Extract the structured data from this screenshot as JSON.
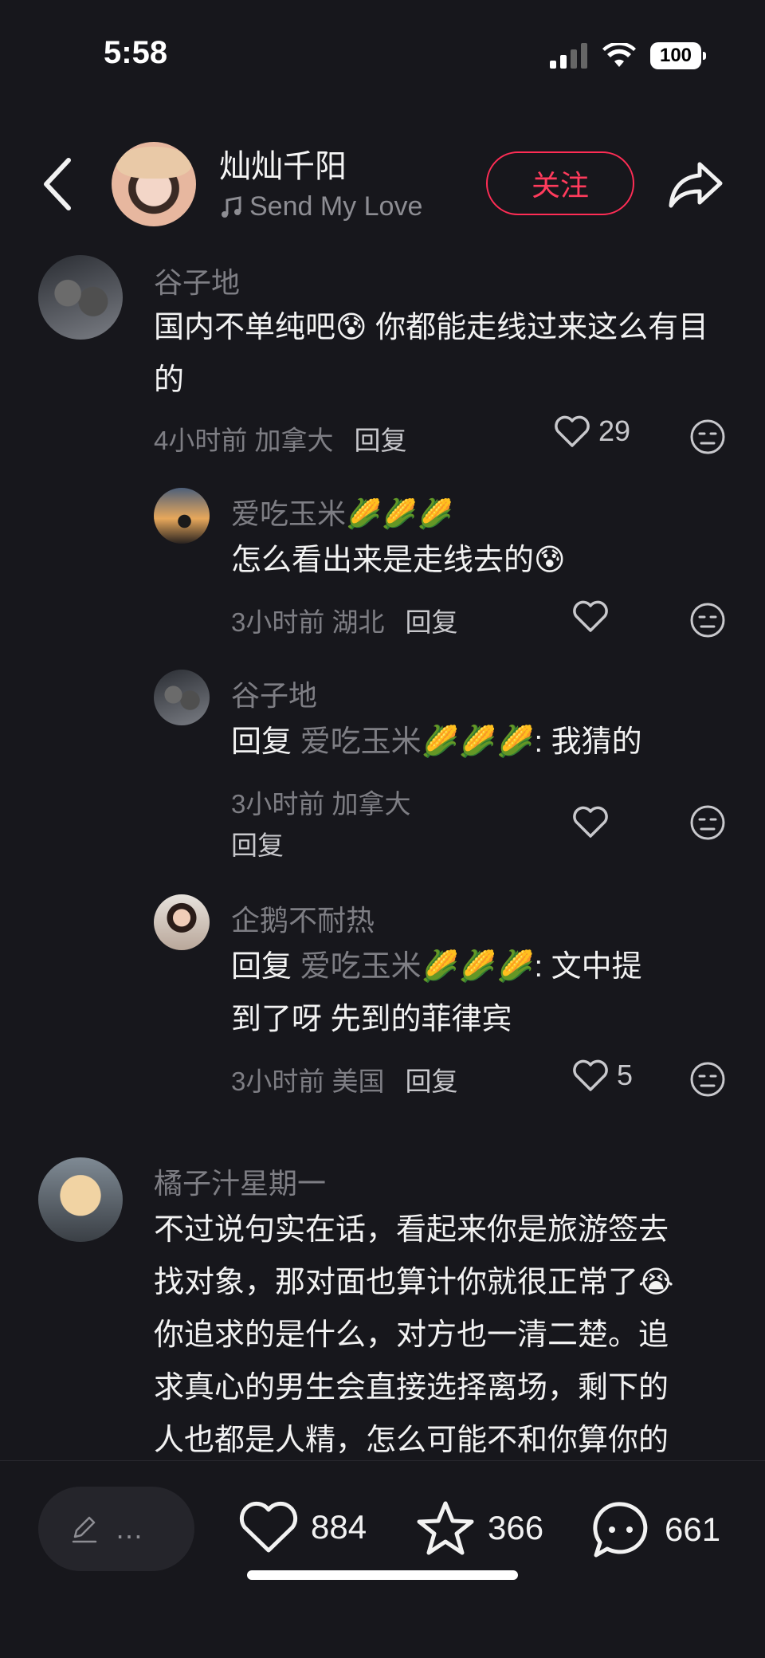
{
  "status": {
    "time": "5:58",
    "battery": "100"
  },
  "header": {
    "author_name": "灿灿千阳",
    "music_title": "Send My Love",
    "follow_label": "关注"
  },
  "comments": [
    {
      "name": "谷子地",
      "text": "国内不单纯吧😰 你都能走线过来这么有目的",
      "time_loc": "4小时前 加拿大",
      "reply_label": "回复",
      "likes": "29"
    },
    {
      "name": "爱吃玉米🌽🌽🌽",
      "text": "怎么看出来是走线去的😰",
      "time_loc": "3小时前 湖北",
      "reply_label": "回复",
      "likes": ""
    },
    {
      "name": "谷子地",
      "reply_prefix": "回复",
      "reply_to": "爱吃玉米🌽🌽🌽",
      "text": ": 我猜的",
      "time_loc": "3小时前 加拿大",
      "reply_label": "回复",
      "likes": ""
    },
    {
      "name": "企鹅不耐热",
      "reply_prefix": "回复",
      "reply_to": "爱吃玉米🌽🌽🌽",
      "text_line1": ": 文中提",
      "text_line2": "到了呀 先到的菲律宾",
      "time_loc": "3小时前 美国",
      "reply_label": "回复",
      "likes": "5"
    },
    {
      "name": "橘子汁星期一",
      "lines": [
        "不过说句实在话，看起来你是旅游签去",
        "找对象，那对面也算计你就很正常了😭",
        "你追求的是什么，对方也一清二楚。追",
        "求真心的男生会直接选择离场，剩下的",
        "人也都是人精，怎么可能不和你算你的"
      ]
    }
  ],
  "bottom": {
    "input_placeholder": "…",
    "likes": "884",
    "favorites": "366",
    "comments": "661"
  }
}
